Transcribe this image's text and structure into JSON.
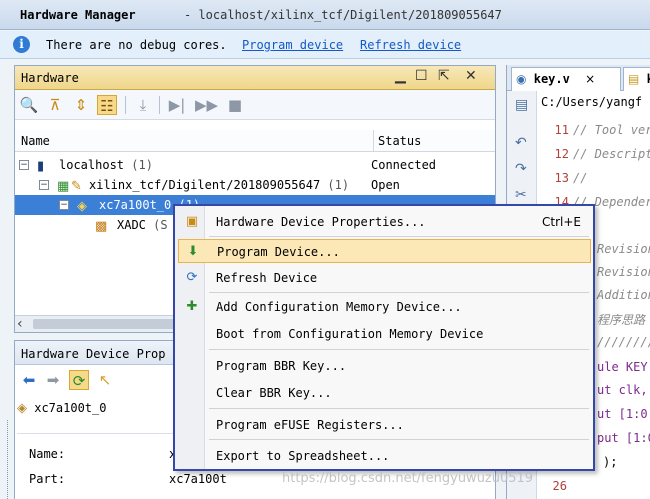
{
  "titlebar": {
    "title": "Hardware Manager",
    "path": "- localhost/xilinx_tcf/Digilent/201809055647"
  },
  "infobar": {
    "message": "There are no debug cores.",
    "link_program": "Program device",
    "link_refresh": "Refresh device"
  },
  "hardware_panel": {
    "title": "Hardware",
    "columns": {
      "name": "Name",
      "status": "Status"
    },
    "rows": [
      {
        "name": "localhost",
        "count": "(1)",
        "status": "Connected"
      },
      {
        "name": "xilinx_tcf/Digilent/201809055647",
        "count": "(1)",
        "status": "Open"
      },
      {
        "name": "xc7a100t_0",
        "count": "(1)",
        "status": ""
      },
      {
        "name": "XADC",
        "count": "(S",
        "status": ""
      }
    ]
  },
  "props_panel": {
    "title": "Hardware Device Prop",
    "device": "xc7a100t_0",
    "fields": [
      {
        "label": "Name:",
        "value": "x"
      },
      {
        "label": "Part:",
        "value": "xc7a100t"
      }
    ]
  },
  "editor": {
    "tabs": [
      {
        "label": "key.v",
        "close": "×"
      },
      {
        "label": "k"
      }
    ],
    "path": "C:/Users/yangf",
    "lines": [
      {
        "num": "11",
        "text": "// Tool ver"
      },
      {
        "num": "12",
        "text": "// Descript"
      },
      {
        "num": "13",
        "text": "//"
      },
      {
        "num": "14",
        "text": "// Depender"
      }
    ],
    "side_text": [
      "Revision",
      "Revision",
      "Addition",
      "程序思路",
      "////////"
    ],
    "code_lines": [
      "ule KEY",
      "ut clk,",
      "ut [1:0",
      "put [1:0",
      ");"
    ],
    "last_line_num": "26"
  },
  "context_menu": {
    "items": [
      {
        "label": "Hardware Device Properties...",
        "shortcut": "Ctrl+E",
        "icon": "properties-icon"
      },
      {
        "label": "Program Device...",
        "icon": "program-icon"
      },
      {
        "label": "Refresh Device",
        "icon": "refresh-icon"
      },
      {
        "label": "Add Configuration Memory Device...",
        "icon": "add-memory-icon"
      },
      {
        "label": "Boot from Configuration Memory Device"
      },
      {
        "label": "Program BBR Key..."
      },
      {
        "label": "Clear BBR Key..."
      },
      {
        "label": "Program eFUSE Registers..."
      },
      {
        "label": "Export to Spreadsheet..."
      }
    ]
  },
  "watermark": "https://blog.csdn.net/fengyuwuzu0519"
}
